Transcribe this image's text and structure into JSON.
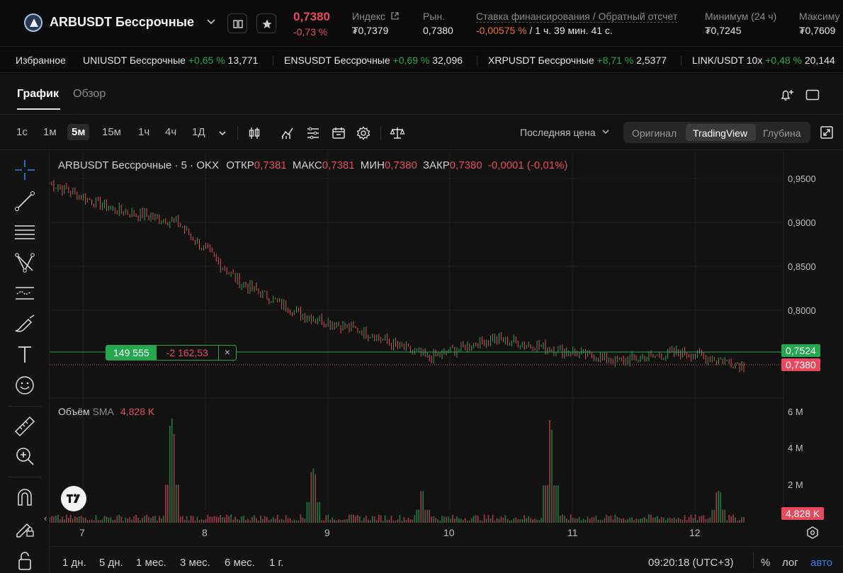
{
  "header": {
    "symbol": "ARBUSDT Бессрочные",
    "last_price": "0,7380",
    "change": "-0,73 %",
    "index_label": "Индекс",
    "index_value": "₮0,7379",
    "mark_label": "Рын.",
    "mark_value": "0,7380",
    "funding_label": "Ставка финансирования / Обратный отсчет",
    "funding_rate": "-0,00575 %",
    "funding_countdown": "/ 1 ч. 39 мин. 41 с.",
    "low_label": "Минимум (24 ч)",
    "low_value": "₮0,7245",
    "high_label": "Максиму",
    "high_value": "₮0,7609"
  },
  "favorites": {
    "label": "Избранное",
    "items": [
      {
        "name": "UNIUSDT Бессрочные",
        "change": "+0,65 %",
        "price": "13,771"
      },
      {
        "name": "ENSUSDT Бессрочные",
        "change": "+0,69 %",
        "price": "32,096"
      },
      {
        "name": "XRPUSDT Бессрочные",
        "change": "+8,71 %",
        "price": "2,5377"
      },
      {
        "name": "LINK/USDT 10x",
        "change": "+0,48 %",
        "price": "20,144"
      }
    ]
  },
  "tabs": {
    "chart": "График",
    "overview": "Обзор"
  },
  "timeframes": [
    "1с",
    "1м",
    "5м",
    "15м",
    "1ч",
    "4ч",
    "1Д"
  ],
  "price_type": "Последняя цена",
  "views": {
    "original": "Оригинал",
    "tradingview": "TradingView",
    "depth": "Глубина"
  },
  "legend": {
    "title": "ARBUSDT Бессрочные · 5 · OKX",
    "open_label": "ОТКР",
    "open": "0,7381",
    "high_label": "МАКС",
    "high": "0,7381",
    "low_label": "МИН",
    "low": "0,7380",
    "close_label": "ЗАКР",
    "close": "0,7380",
    "change": "-0,0001 (-0,01%)"
  },
  "volume_legend": {
    "label": "Объём",
    "sma": "SMA",
    "value": "4,828 K"
  },
  "position": {
    "qty": "149 555",
    "pnl": "-2 162,53",
    "close": "×"
  },
  "price_axis": [
    "0,9500",
    "0,9000",
    "0,8500",
    "0,8000"
  ],
  "entry_tag": "0,7524",
  "last_tag": "0,7380",
  "volume_axis": [
    "6 M",
    "4 M",
    "2 M"
  ],
  "volume_tag": "4,828 K",
  "time_axis": [
    "7",
    "8",
    "9",
    "10",
    "11",
    "12"
  ],
  "ranges": [
    "1 дн.",
    "5 дн.",
    "1 мес.",
    "3 мес.",
    "6 мес.",
    "1 г."
  ],
  "clock": "09:20:18 (UTC+3)",
  "scale": {
    "percent": "%",
    "log": "лог",
    "auto": "авто"
  },
  "colors": {
    "up": "#25a750",
    "down": "#e54a5f",
    "accent": "#2f7ff0",
    "funding": "#f36f2d"
  },
  "chart_data": {
    "type": "line",
    "description_series": "ARBUSDT 5m price path (approx. close)",
    "x": [
      "7",
      "7.5",
      "8",
      "8.5",
      "9",
      "9.5",
      "10",
      "10.5",
      "11",
      "11.5",
      "12",
      "12.4"
    ],
    "series": [
      {
        "values": [
          0.945,
          0.915,
          0.901,
          0.832,
          0.795,
          0.775,
          0.745,
          0.768,
          0.756,
          0.742,
          0.752,
          0.738
        ]
      }
    ],
    "ylim": [
      0.72,
      0.96
    ],
    "volume_ylim": [
      0,
      6
    ],
    "volume_peaks_M": [
      {
        "x": "7.75",
        "v": 5.9
      },
      {
        "x": "8.85",
        "v": 3.2
      },
      {
        "x": "9.7",
        "v": 2.0
      },
      {
        "x": "10.7",
        "v": 5.8
      },
      {
        "x": "12",
        "v": 2.0
      }
    ]
  }
}
